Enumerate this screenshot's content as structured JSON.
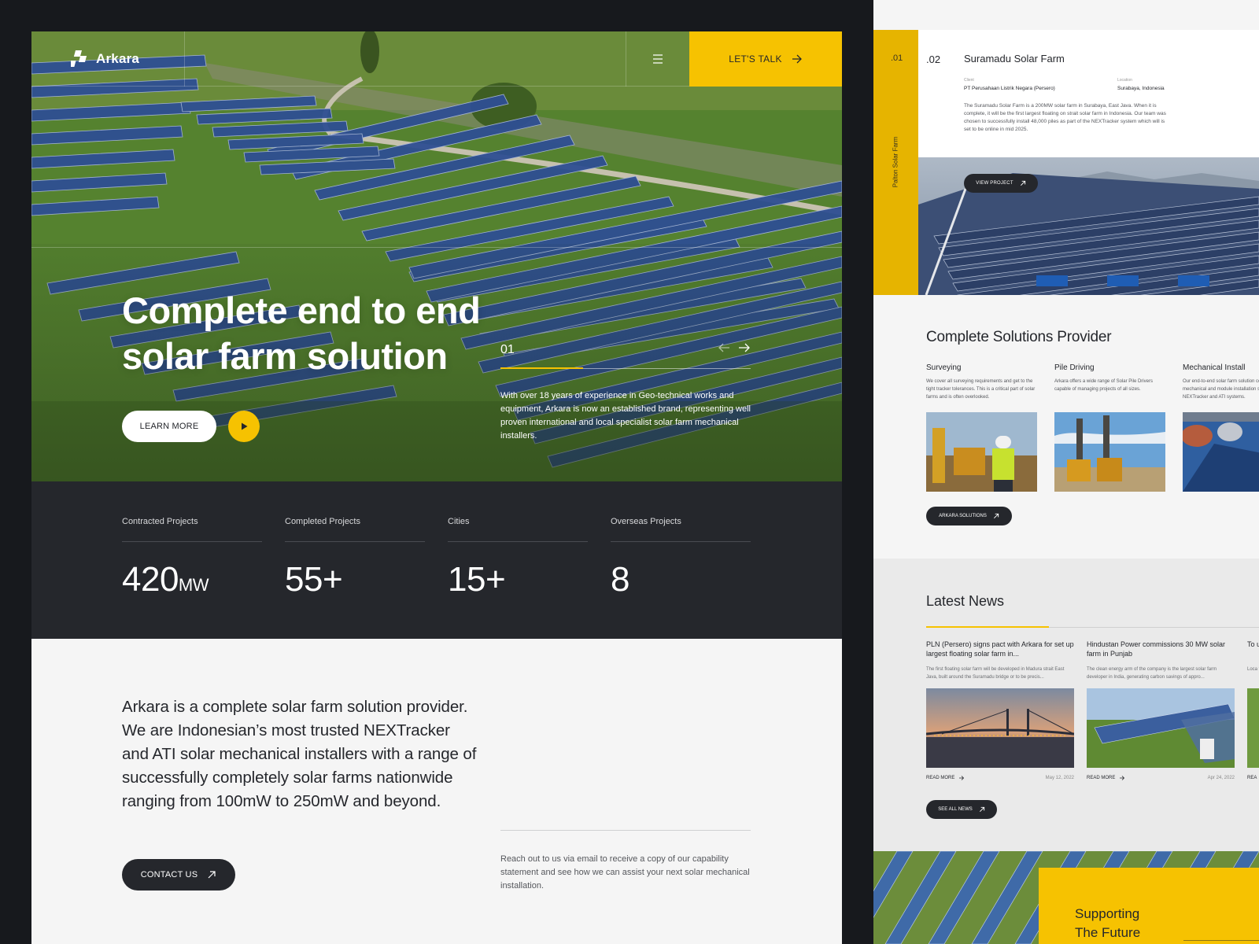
{
  "header": {
    "brand": "Arkara",
    "cta_label": "LET'S TALK"
  },
  "hero": {
    "title_light_1": "Complete ",
    "title_bold": "end to end",
    "title_light_2": "solar farm solution",
    "learn_label": "LEARN MORE",
    "slide_number": "01",
    "slide_progress": 0.33,
    "description": "With over 18 years of experience in Geo-technical works and equipment, Arkara is now an established brand, representing well proven international and local specialist solar farm mechanical installers."
  },
  "stats": [
    {
      "label": "Contracted Projects",
      "value": "420",
      "unit": "MW"
    },
    {
      "label": "Completed Projects",
      "value": "55+",
      "unit": ""
    },
    {
      "label": "Cities",
      "value": "15+",
      "unit": ""
    },
    {
      "label": "Overseas Projects",
      "value": "8",
      "unit": ""
    }
  ],
  "about": {
    "text": "Arkara is a complete solar farm solution provider. We are Indonesian’s most trusted NEXTracker and ATI solar mechanical installers with a range of successfully completely solar farms nationwide ranging from 100mW to 250mW and beyond.",
    "contact_label": "CONTACT US",
    "note": "Reach out to us via email to receive a copy of our capability statement and see how we can assist your next solar mechanical installation."
  },
  "project": {
    "prev_number": ".01",
    "prev_name": "Palton Solar Farm",
    "number": ".02",
    "title": "Suramadu Solar Farm",
    "client_label": "Client",
    "client": "PT Perusahaan Listrik Negara (Persero)",
    "location_label": "Location",
    "location": "Surabaya, Indonesia",
    "description": "The Suramadu Solar Farm is a 200MW solar farm in Surabaya, East Java. When it is complete, it will be the first largest floating on strait solar farm in Indonesia. Our team was chosen to successfully install 48,000 piles as part of the NEXTracker system which will is set to be online in mid 2025.",
    "view_label": "VIEW PROJECT"
  },
  "solutions": {
    "title": "Complete Solutions Provider",
    "items": [
      {
        "name": "Surveying",
        "desc": "We cover all surveying requirements and get to the tight tracker tolerances. This is a critical part of solar farms and is often overlooked."
      },
      {
        "name": "Pile Driving",
        "desc": "Arkara offers a wide range of Solar Pile Drivers capable of managing projects of all sizes."
      },
      {
        "name": "Mechanical Install",
        "desc": "Our end-to-end solar farm solution covers mechanical and module installation services in NEXTracker and ATI systems."
      }
    ],
    "button_label": "ARKARA SOLUTIONS"
  },
  "news": {
    "title": "Latest News",
    "items": [
      {
        "headline": "PLN (Persero) signs pact with Arkara for set up largest floating solar farm in...",
        "desc": "The first floating solar farm will be developed in Madura strait East Java, built around the Suramadu bridge or to be precis...",
        "read": "READ MORE",
        "date": "May 12, 2022"
      },
      {
        "headline": "Hindustan Power commissions 30 MW solar farm in Punjab",
        "desc": "The clean energy arm of the company is the largest solar farm developer in India, generating carbon savings of appro...",
        "read": "READ MORE",
        "date": "Apr 24, 2022"
      },
      {
        "headline": "To up",
        "desc": "Loca the s",
        "read": "REA",
        "date": ""
      }
    ],
    "button_label": "SEE ALL NEWS"
  },
  "footer_card": {
    "line1": "Supporting",
    "line2": "The Future"
  },
  "colors": {
    "accent": "#f6c201",
    "dark": "#25272c",
    "background": "#17191d",
    "light": "#f5f5f5"
  }
}
